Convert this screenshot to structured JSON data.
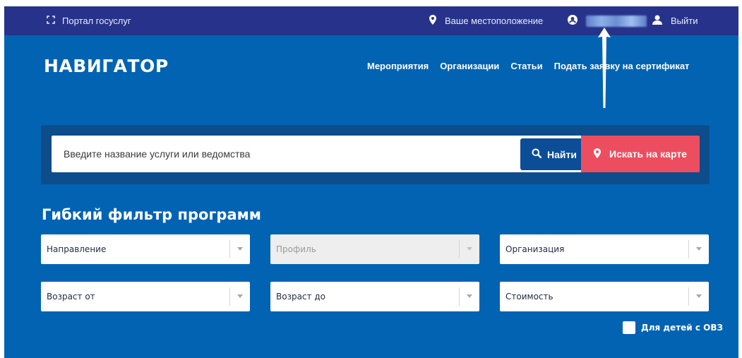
{
  "topbar": {
    "portal_label": "Портал госуслуг",
    "location_label": "Ваше местоположение",
    "logout_label": "Выйти"
  },
  "header": {
    "logo": "НАВИГАТОР",
    "nav": [
      "Мероприятия",
      "Организации",
      "Статьи",
      "Подать заявку на сертификат"
    ]
  },
  "search": {
    "placeholder": "Введите название услуги или ведомства",
    "find_label": "Найти",
    "map_label": "Искать на карте"
  },
  "filters": {
    "title": "Гибкий фильтр программ",
    "direction": "Направление",
    "profile": "Профиль",
    "organization": "Организация",
    "age_from": "Возраст от",
    "age_to": "Возраст до",
    "cost": "Стоимость",
    "ovz_label": "Для детей с ОВЗ"
  },
  "colors": {
    "topbar": "#27338a",
    "page": "#0263b3",
    "find_button": "#0b4e97",
    "map_button": "#ed4e5f"
  }
}
